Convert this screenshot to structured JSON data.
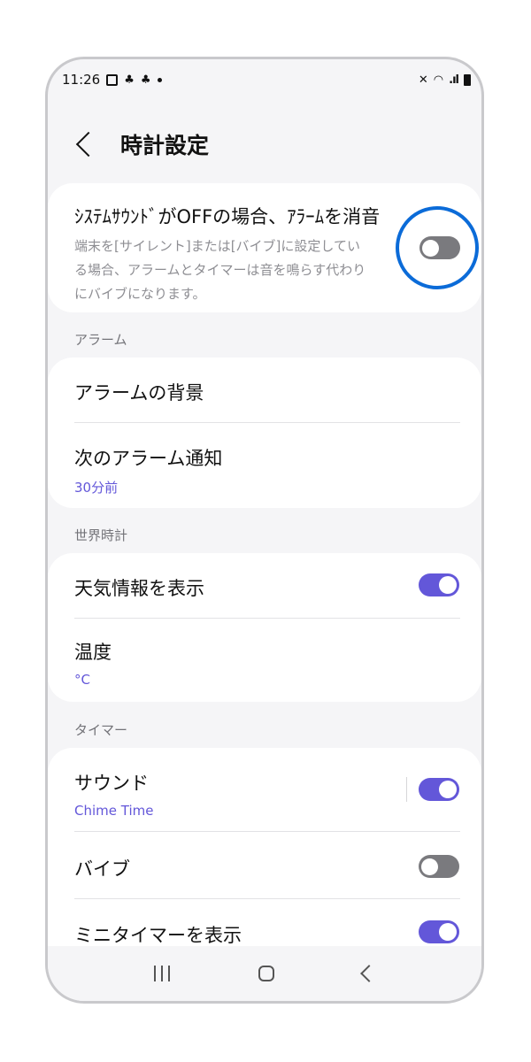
{
  "status_bar": {
    "time": "11:26",
    "icons": [
      "gallery-icon",
      "assistant-icon",
      "assistant-icon",
      "dot-icon"
    ],
    "right_icons": [
      "mute-icon",
      "wifi-icon",
      "signal-icon",
      "battery-icon"
    ]
  },
  "header": {
    "title": "時計設定"
  },
  "top_setting": {
    "title": "ｼｽﾃﾑｻｳﾝﾄﾞがOFFの場合、ｱﾗｰﾑを消音",
    "description_lines": [
      "端末を[サイレント]または[バイブ]に設定してい",
      "る場合、アラームとタイマーは音を鳴らす代わり",
      "にバイブになります。"
    ],
    "toggle": "off"
  },
  "alarm_section": {
    "label": "アラーム",
    "items": [
      {
        "title": "アラームの背景"
      },
      {
        "title": "次のアラーム通知",
        "subtitle": "30分前"
      }
    ]
  },
  "world_clock_section": {
    "label": "世界時計",
    "items": [
      {
        "title": "天気情報を表示",
        "toggle": "on"
      },
      {
        "title": "温度",
        "subtitle": "°C"
      }
    ]
  },
  "timer_section": {
    "label": "タイマー",
    "items": [
      {
        "title": "サウンド",
        "subtitle": "Chime Time",
        "toggle": "on"
      },
      {
        "title": "バイブ",
        "toggle": "off"
      },
      {
        "title": "ミニタイマーを表示",
        "toggle": "on"
      }
    ]
  },
  "colors": {
    "accent": "#6357d9",
    "highlight": "#0b6bd8",
    "background": "#f5f5f7"
  }
}
